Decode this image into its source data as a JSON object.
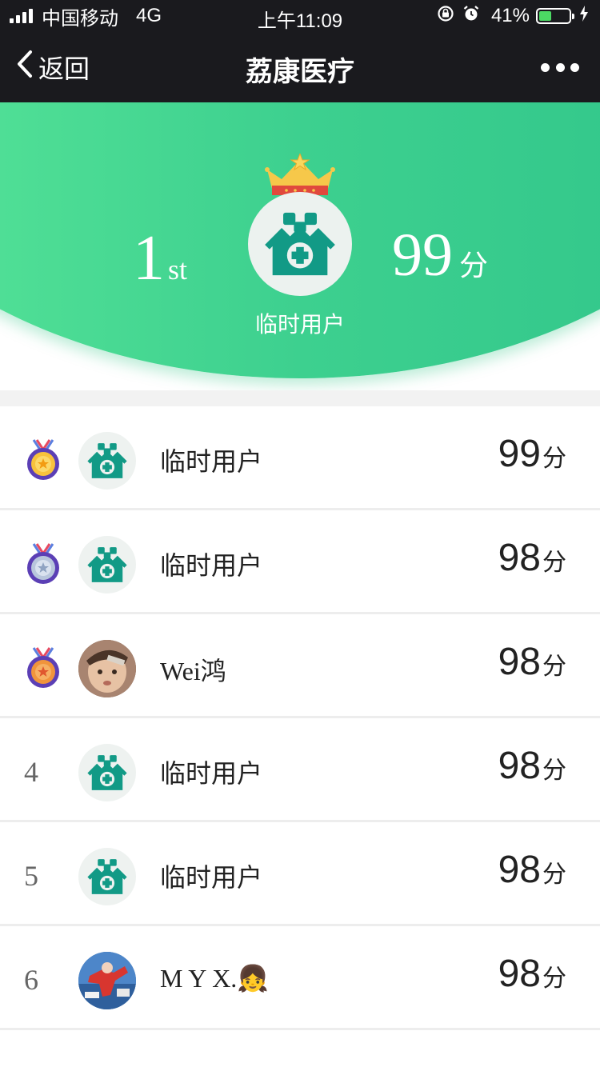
{
  "status_bar": {
    "carrier": "中国移动",
    "network": "4G",
    "time": "上午11:09",
    "battery": "41%",
    "battery_level": 0.41
  },
  "nav": {
    "back_label": "返回",
    "title": "荔康医疗"
  },
  "top_user": {
    "rank": "1",
    "rank_suffix": "st",
    "score": "99",
    "score_unit": "分",
    "name": "临时用户",
    "avatar": "hospital-logo"
  },
  "colors": {
    "accent_green": "#3dd08f",
    "logo_teal": "#129a86",
    "gold": "#f6c84a"
  },
  "score_unit": "分",
  "rankings": [
    {
      "rank": "1",
      "rank_display": "gold-medal-icon",
      "name": "临时用户",
      "score": "99",
      "avatar": "hospital-logo"
    },
    {
      "rank": "2",
      "rank_display": "silver-medal-icon",
      "name": "临时用户",
      "score": "98",
      "avatar": "hospital-logo"
    },
    {
      "rank": "3",
      "rank_display": "bronze-medal-icon",
      "name": "Wei鸿",
      "score": "98",
      "avatar": "user-photo"
    },
    {
      "rank": "4",
      "rank_display": "4",
      "name": "临时用户",
      "score": "98",
      "avatar": "hospital-logo"
    },
    {
      "rank": "5",
      "rank_display": "5",
      "name": "临时用户",
      "score": "98",
      "avatar": "hospital-logo"
    },
    {
      "rank": "6",
      "rank_display": "6",
      "name": "M Y X.👧",
      "score": "98",
      "avatar": "user-photo"
    }
  ]
}
